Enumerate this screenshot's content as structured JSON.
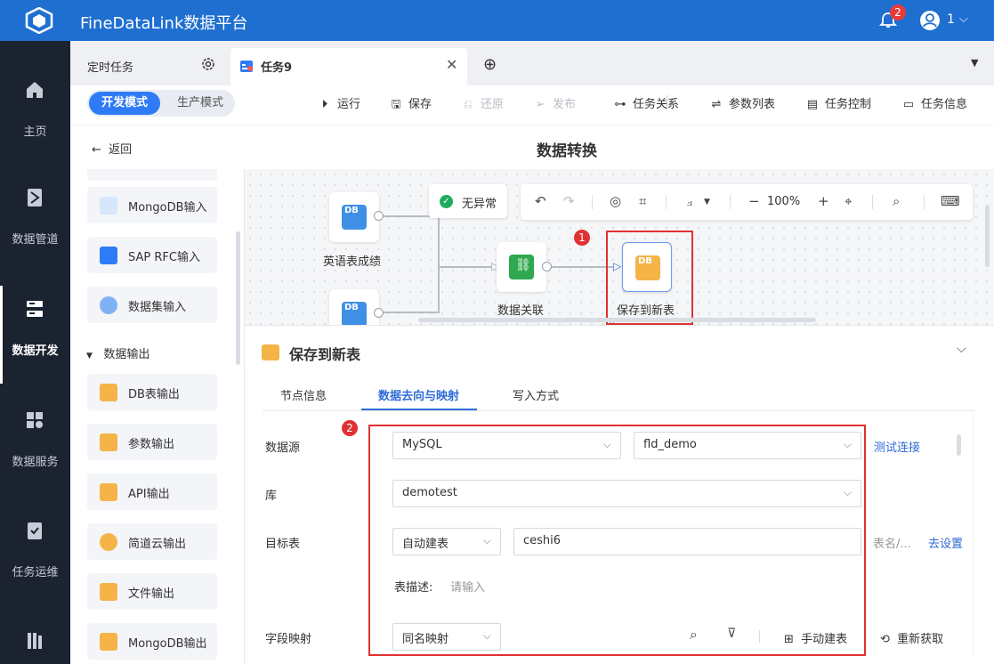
{
  "app": {
    "title": "FineDataLink数据平台",
    "notification_count": "2",
    "user_name": "1"
  },
  "nav": [
    {
      "label": "主页",
      "icon": "home-icon"
    },
    {
      "label": "数据管道",
      "icon": "pipeline-icon"
    },
    {
      "label": "数据开发",
      "icon": "data-dev-icon",
      "active": true
    },
    {
      "label": "数据服务",
      "icon": "data-service-icon"
    },
    {
      "label": "任务运维",
      "icon": "task-ops-icon"
    },
    {
      "label": "",
      "icon": "more-icon"
    }
  ],
  "tabs": {
    "tab1": "定时任务",
    "tab2": "任务9"
  },
  "toolbar": {
    "mode_dev": "开发模式",
    "mode_prod": "生产模式",
    "run": "运行",
    "save": "保存",
    "restore": "还原",
    "publish": "发布",
    "task_relation": "任务关系",
    "param_list": "参数列表",
    "task_control": "任务控制",
    "task_info": "任务信息"
  },
  "header": {
    "back": "返回",
    "title": "数据转换"
  },
  "palette": {
    "items_top": [
      "MongoDB输入",
      "SAP RFC输入",
      "数据集输入"
    ],
    "group": "数据输出",
    "items_output": [
      "DB表输出",
      "参数输出",
      "API输出",
      "简道云输出",
      "文件输出",
      "MongoDB输出"
    ]
  },
  "canvas": {
    "status": "无异常",
    "zoom": "100%",
    "nodes": {
      "source1": "英语表成绩",
      "join": "数据关联",
      "target": "保存到新表"
    },
    "node_badge_db": "DB",
    "step1": "1"
  },
  "panel": {
    "title": "保存到新表",
    "tabs": [
      "节点信息",
      "数据去向与映射",
      "写入方式"
    ],
    "step2": "2",
    "datasource_label": "数据源",
    "datasource_type": "MySQL",
    "datasource_conn": "fld_demo",
    "test_connection": "测试连接",
    "db_label": "库",
    "db_value": "demotest",
    "target_label": "目标表",
    "target_mode": "自动建表",
    "target_name": "ceshi6",
    "table_name_hint": "表名/...",
    "go_settings": "去设置",
    "desc_label": "表描述:",
    "desc_placeholder": "请输入",
    "mapping_label": "字段映射",
    "mapping_mode": "同名映射",
    "manual_build": "手动建表",
    "refetch": "重新获取"
  },
  "colors": {
    "brand": "#1f6fd1",
    "nav_bg": "#1b2331",
    "accent": "#2f7bf6",
    "highlight": "#e03131"
  }
}
